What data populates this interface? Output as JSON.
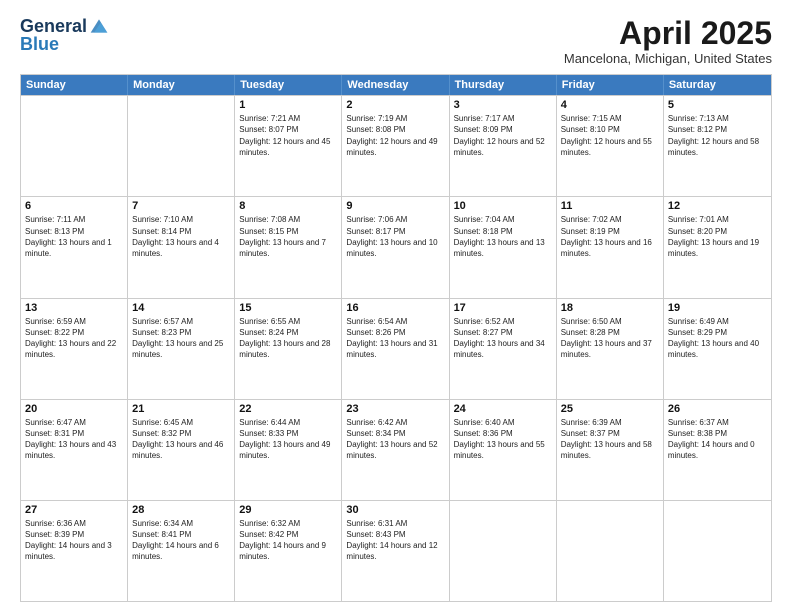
{
  "logo": {
    "general": "General",
    "blue": "Blue"
  },
  "title": "April 2025",
  "location": "Mancelona, Michigan, United States",
  "days_of_week": [
    "Sunday",
    "Monday",
    "Tuesday",
    "Wednesday",
    "Thursday",
    "Friday",
    "Saturday"
  ],
  "weeks": [
    [
      {
        "day": "",
        "info": ""
      },
      {
        "day": "",
        "info": ""
      },
      {
        "day": "1",
        "info": "Sunrise: 7:21 AM\nSunset: 8:07 PM\nDaylight: 12 hours and 45 minutes."
      },
      {
        "day": "2",
        "info": "Sunrise: 7:19 AM\nSunset: 8:08 PM\nDaylight: 12 hours and 49 minutes."
      },
      {
        "day": "3",
        "info": "Sunrise: 7:17 AM\nSunset: 8:09 PM\nDaylight: 12 hours and 52 minutes."
      },
      {
        "day": "4",
        "info": "Sunrise: 7:15 AM\nSunset: 8:10 PM\nDaylight: 12 hours and 55 minutes."
      },
      {
        "day": "5",
        "info": "Sunrise: 7:13 AM\nSunset: 8:12 PM\nDaylight: 12 hours and 58 minutes."
      }
    ],
    [
      {
        "day": "6",
        "info": "Sunrise: 7:11 AM\nSunset: 8:13 PM\nDaylight: 13 hours and 1 minute."
      },
      {
        "day": "7",
        "info": "Sunrise: 7:10 AM\nSunset: 8:14 PM\nDaylight: 13 hours and 4 minutes."
      },
      {
        "day": "8",
        "info": "Sunrise: 7:08 AM\nSunset: 8:15 PM\nDaylight: 13 hours and 7 minutes."
      },
      {
        "day": "9",
        "info": "Sunrise: 7:06 AM\nSunset: 8:17 PM\nDaylight: 13 hours and 10 minutes."
      },
      {
        "day": "10",
        "info": "Sunrise: 7:04 AM\nSunset: 8:18 PM\nDaylight: 13 hours and 13 minutes."
      },
      {
        "day": "11",
        "info": "Sunrise: 7:02 AM\nSunset: 8:19 PM\nDaylight: 13 hours and 16 minutes."
      },
      {
        "day": "12",
        "info": "Sunrise: 7:01 AM\nSunset: 8:20 PM\nDaylight: 13 hours and 19 minutes."
      }
    ],
    [
      {
        "day": "13",
        "info": "Sunrise: 6:59 AM\nSunset: 8:22 PM\nDaylight: 13 hours and 22 minutes."
      },
      {
        "day": "14",
        "info": "Sunrise: 6:57 AM\nSunset: 8:23 PM\nDaylight: 13 hours and 25 minutes."
      },
      {
        "day": "15",
        "info": "Sunrise: 6:55 AM\nSunset: 8:24 PM\nDaylight: 13 hours and 28 minutes."
      },
      {
        "day": "16",
        "info": "Sunrise: 6:54 AM\nSunset: 8:26 PM\nDaylight: 13 hours and 31 minutes."
      },
      {
        "day": "17",
        "info": "Sunrise: 6:52 AM\nSunset: 8:27 PM\nDaylight: 13 hours and 34 minutes."
      },
      {
        "day": "18",
        "info": "Sunrise: 6:50 AM\nSunset: 8:28 PM\nDaylight: 13 hours and 37 minutes."
      },
      {
        "day": "19",
        "info": "Sunrise: 6:49 AM\nSunset: 8:29 PM\nDaylight: 13 hours and 40 minutes."
      }
    ],
    [
      {
        "day": "20",
        "info": "Sunrise: 6:47 AM\nSunset: 8:31 PM\nDaylight: 13 hours and 43 minutes."
      },
      {
        "day": "21",
        "info": "Sunrise: 6:45 AM\nSunset: 8:32 PM\nDaylight: 13 hours and 46 minutes."
      },
      {
        "day": "22",
        "info": "Sunrise: 6:44 AM\nSunset: 8:33 PM\nDaylight: 13 hours and 49 minutes."
      },
      {
        "day": "23",
        "info": "Sunrise: 6:42 AM\nSunset: 8:34 PM\nDaylight: 13 hours and 52 minutes."
      },
      {
        "day": "24",
        "info": "Sunrise: 6:40 AM\nSunset: 8:36 PM\nDaylight: 13 hours and 55 minutes."
      },
      {
        "day": "25",
        "info": "Sunrise: 6:39 AM\nSunset: 8:37 PM\nDaylight: 13 hours and 58 minutes."
      },
      {
        "day": "26",
        "info": "Sunrise: 6:37 AM\nSunset: 8:38 PM\nDaylight: 14 hours and 0 minutes."
      }
    ],
    [
      {
        "day": "27",
        "info": "Sunrise: 6:36 AM\nSunset: 8:39 PM\nDaylight: 14 hours and 3 minutes."
      },
      {
        "day": "28",
        "info": "Sunrise: 6:34 AM\nSunset: 8:41 PM\nDaylight: 14 hours and 6 minutes."
      },
      {
        "day": "29",
        "info": "Sunrise: 6:32 AM\nSunset: 8:42 PM\nDaylight: 14 hours and 9 minutes."
      },
      {
        "day": "30",
        "info": "Sunrise: 6:31 AM\nSunset: 8:43 PM\nDaylight: 14 hours and 12 minutes."
      },
      {
        "day": "",
        "info": ""
      },
      {
        "day": "",
        "info": ""
      },
      {
        "day": "",
        "info": ""
      }
    ]
  ]
}
